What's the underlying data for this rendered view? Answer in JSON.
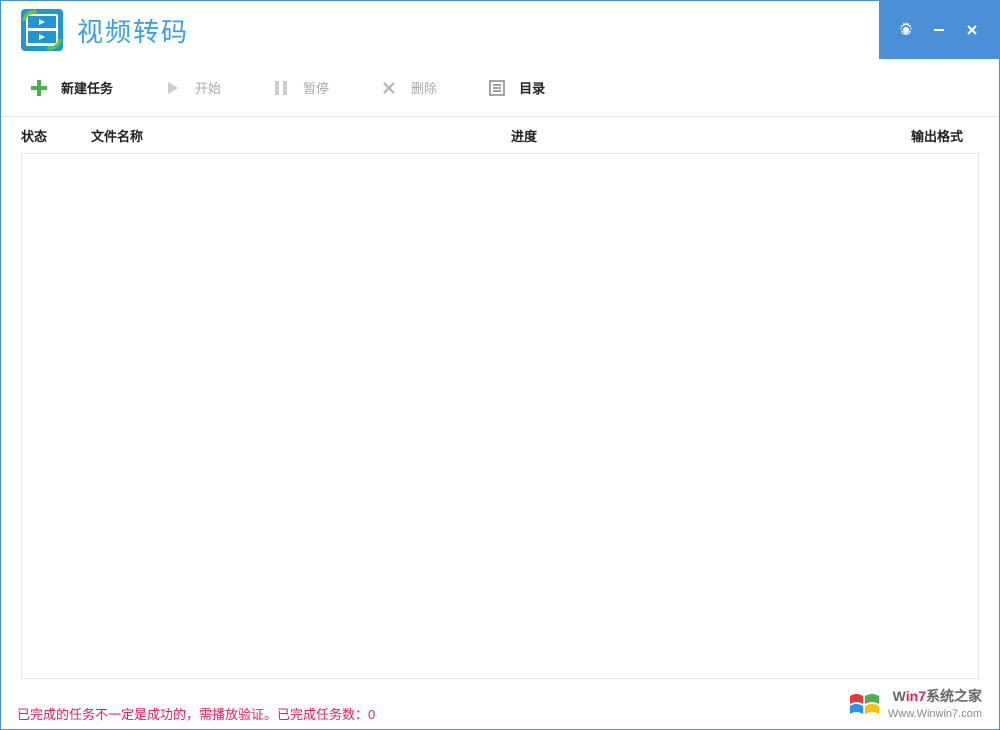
{
  "app": {
    "title": "视频转码"
  },
  "toolbar": {
    "new_task": "新建任务",
    "start": "开始",
    "pause": "暂停",
    "delete": "删除",
    "directory": "目录"
  },
  "table": {
    "columns": {
      "status": "状态",
      "filename": "文件名称",
      "progress": "进度",
      "output_format": "输出格式"
    },
    "rows": []
  },
  "status": {
    "message": "已完成的任务不一定是成功的，需播放验证。已完成任务数：0"
  },
  "watermark": {
    "brand_prefix": "W",
    "brand_highlight": "in7",
    "brand_suffix": "系统之家",
    "url": "Www.Winwin7.com"
  }
}
